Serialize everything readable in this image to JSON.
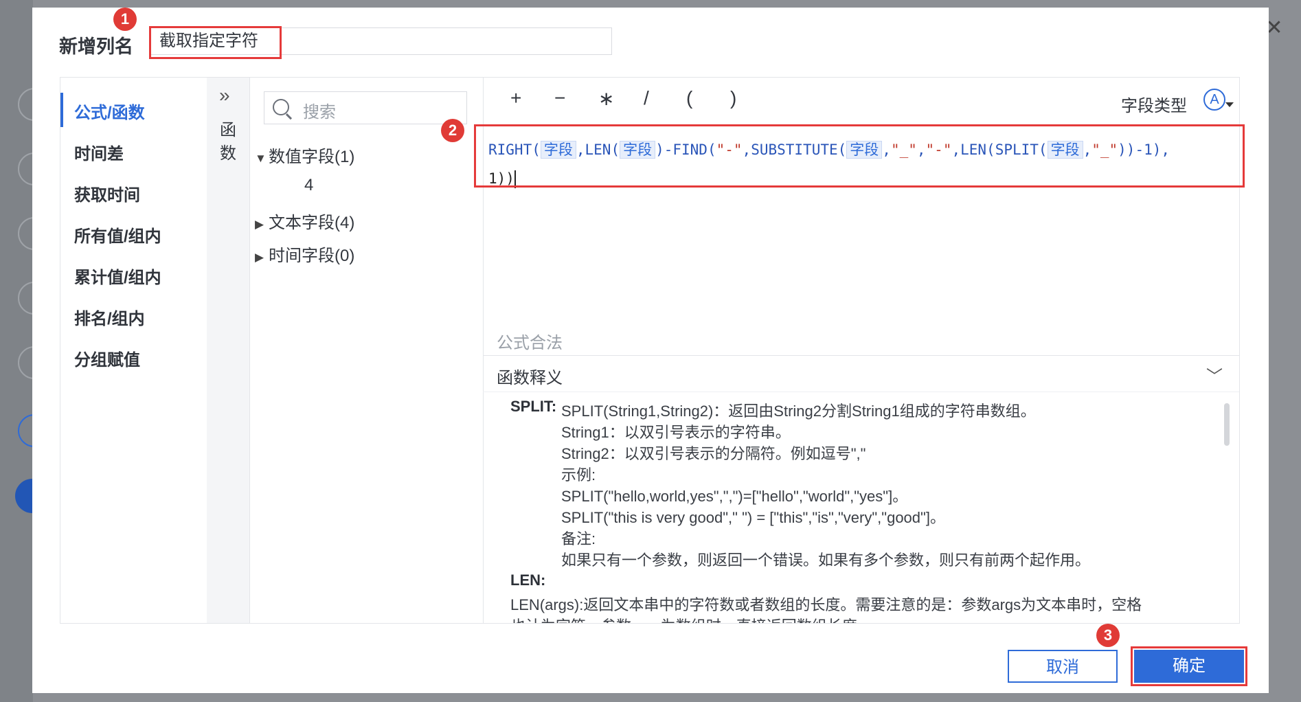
{
  "dialog": {
    "title": "新增列名",
    "column_name_value": "截取指定字符"
  },
  "steps": [
    "1",
    "2",
    "3"
  ],
  "nav": {
    "items": [
      {
        "label": "公式/函数",
        "active": true
      },
      {
        "label": "时间差"
      },
      {
        "label": "获取时间"
      },
      {
        "label": "所有值/组内"
      },
      {
        "label": "累计值/组内"
      },
      {
        "label": "排名/组内"
      },
      {
        "label": "分组赋值"
      }
    ],
    "functions_tab": "函数"
  },
  "fields": {
    "search_placeholder": "搜索",
    "groups": [
      {
        "label": "数值字段(1)",
        "expanded": true,
        "children": [
          "4"
        ]
      },
      {
        "label": "文本字段(4)",
        "expanded": false
      },
      {
        "label": "时间字段(0)",
        "expanded": false
      }
    ]
  },
  "editor": {
    "operators": [
      "+",
      "−",
      "∗",
      "/",
      "(",
      ")"
    ],
    "field_type_label": "字段类型",
    "field_type_icon": "A",
    "field_tag": "字段",
    "formula_tokens": {
      "right": "RIGHT(",
      "len": "LEN(",
      "find": ")-FIND(",
      "dash": "\"-\"",
      "substitute": "SUBSTITUTE(",
      "underscore": "\"_\"",
      "split": "LEN(SPLIT(",
      "minus_one": "))-1),",
      "close": "1))"
    },
    "validity": "公式合法",
    "explain_title": "函数释义"
  },
  "explanation": {
    "split_name": "SPLIT:",
    "split_lines": [
      "SPLIT(String1,String2)：返回由String2分割String1组成的字符串数组。",
      "String1：以双引号表示的字符串。",
      "String2：以双引号表示的分隔符。例如逗号\",\"",
      "示例:",
      "SPLIT(\"hello,world,yes\",\",\")=[\"hello\",\"world\",\"yes\"]。",
      "SPLIT(\"this is very good\",\" \") = [\"this\",\"is\",\"very\",\"good\"]。",
      "备注:",
      "如果只有一个参数，则返回一个错误。如果有多个参数，则只有前两个起作用。"
    ],
    "len_name": "LEN:",
    "len_lines": [
      "LEN(args):返回文本串中的字符数或者数组的长度。需要注意的是：参数args为文本串时，空格",
      "也计为字符。参数args为数组时，直接返回数组长度。"
    ]
  },
  "buttons": {
    "cancel": "取消",
    "ok": "确定"
  },
  "colors": {
    "accent": "#2e6bd8",
    "highlight_box": "#e53a3a"
  }
}
